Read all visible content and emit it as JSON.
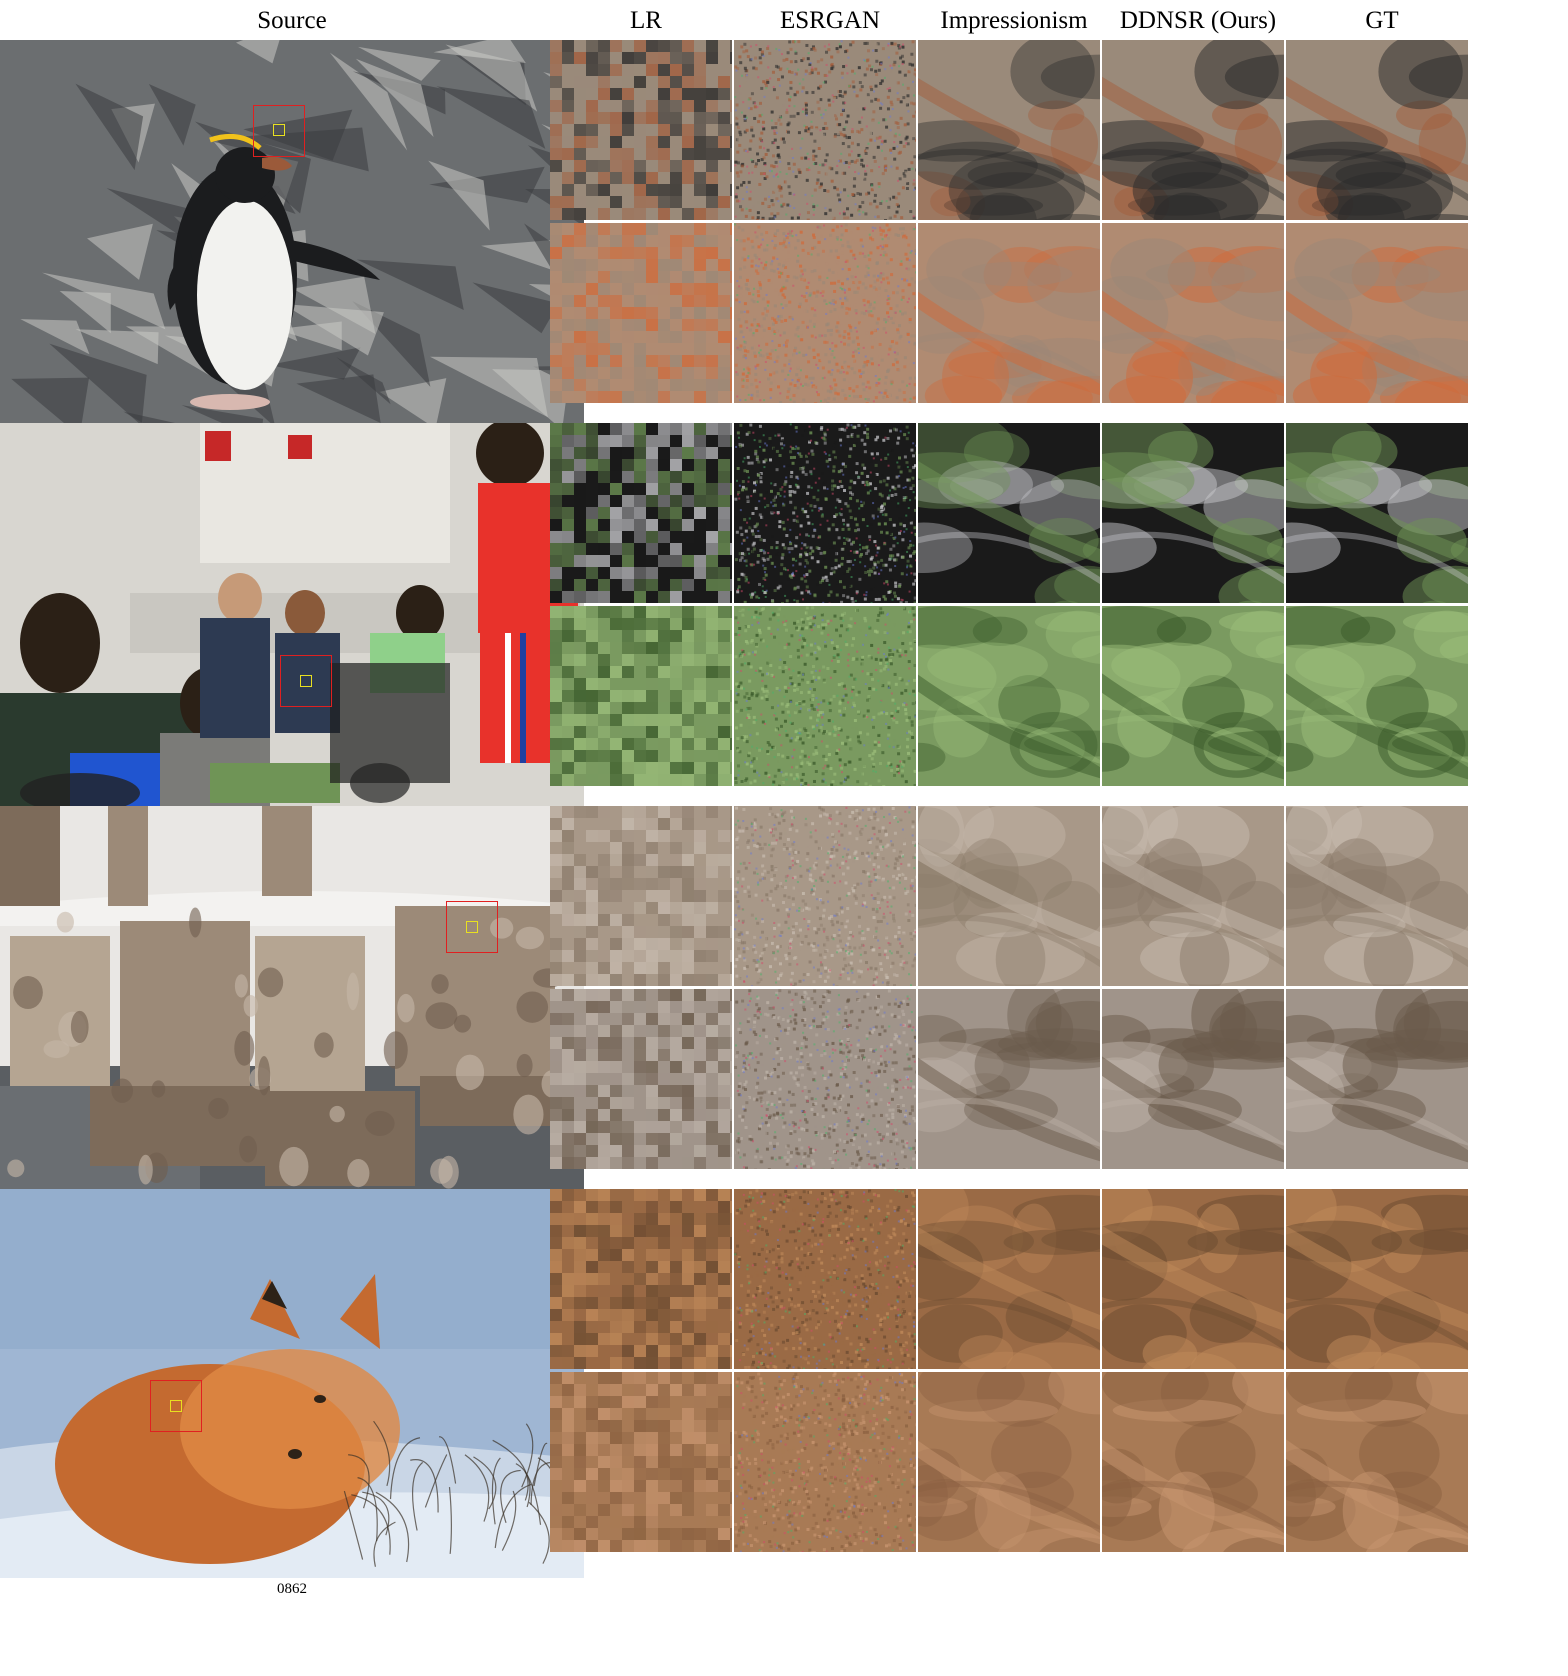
{
  "headers": [
    "Source",
    "LR",
    "ESRGAN",
    "Impressionism",
    "DDNSR (Ours)",
    "GT"
  ],
  "rows": [
    {
      "id": "0801",
      "scene": "penguin on rocks",
      "palette": [
        "#6b6e70",
        "#3a3d40",
        "#c9c9c4",
        "#f2f2ef",
        "#9b5a3a"
      ]
    },
    {
      "id": "0813",
      "scene": "people in wheelchairs",
      "palette": [
        "#d8d6d0",
        "#2d3a52",
        "#e8322b",
        "#6f9456",
        "#2040a0"
      ]
    },
    {
      "id": "0816",
      "scene": "stone carvings in museum",
      "palette": [
        "#e9e7e4",
        "#9c8a78",
        "#7d6b5a",
        "#b5a592",
        "#5a5e62"
      ]
    },
    {
      "id": "0862",
      "scene": "fox in snow",
      "palette": [
        "#9fb6d3",
        "#c9d6e6",
        "#c46a30",
        "#e08a45",
        "#2d2218"
      ]
    }
  ],
  "tile_palettes": [
    [
      [
        "#9a8a7a",
        "#a35d3c",
        "#2a2a2a"
      ],
      [
        "#b08b72",
        "#d06a3a",
        "#9a8877"
      ]
    ],
    [
      [
        "#1a1a1a",
        "#6f9456",
        "#c8c8cc"
      ],
      [
        "#7a9a60",
        "#3a5a2a",
        "#9bbd7a"
      ]
    ],
    [
      [
        "#a89888",
        "#c8bcb0",
        "#8a7a6a"
      ],
      [
        "#a0948a",
        "#6a5a4a",
        "#bdb2a8"
      ]
    ],
    [
      [
        "#9a6a45",
        "#c08a5a",
        "#6a4a30"
      ],
      [
        "#a87a55",
        "#c89570",
        "#8a6040"
      ]
    ]
  ]
}
